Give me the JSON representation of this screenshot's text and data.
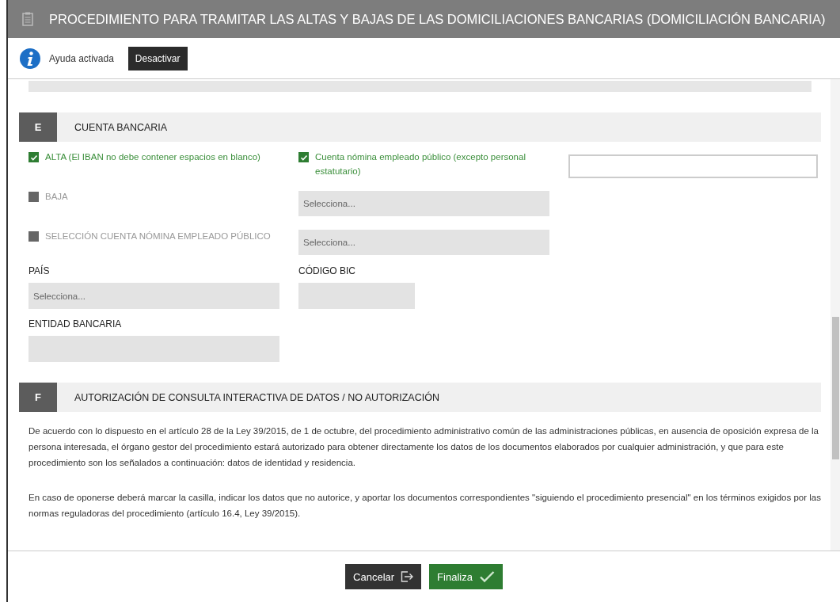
{
  "window": {
    "title": "PROCEDIMIENTO PARA TRAMITAR LAS ALTAS Y BAJAS DE LAS DOMICILIACIONES BANCARIAS (DOMICILIACIÓN BANCARIA)"
  },
  "help": {
    "label": "Ayuda activada",
    "button": "Desactivar"
  },
  "section_e": {
    "letter": "E",
    "title": "CUENTA BANCARIA",
    "options": [
      {
        "label": "ALTA (El IBAN no debe contener espacios en blanco)",
        "checked": true
      },
      {
        "label": "BAJA",
        "checked": false
      },
      {
        "label": "SELECCIÓN CUENTA NÓMINA EMPLEADO PÚBLICO",
        "checked": false
      }
    ],
    "payroll_option": {
      "label": "Cuenta nómina empleado público (excepto personal estatutario)",
      "checked": true
    },
    "payroll_selects": [
      {
        "placeholder": "Selecciona..."
      },
      {
        "placeholder": "Selecciona..."
      }
    ],
    "fields": [
      {
        "label": "PAÍS",
        "placeholder": "Selecciona...",
        "kind": "wide"
      },
      {
        "label": "CÓDIGO BIC",
        "kind": "short"
      },
      {
        "label": "ENTIDAD BANCARIA",
        "kind": "wide"
      }
    ]
  },
  "section_f": {
    "letter": "F",
    "title": "AUTORIZACIÓN DE CONSULTA INTERACTIVA DE DATOS / NO AUTORIZACIÓN",
    "paragraphs": [
      "De acuerdo con lo dispuesto en el artículo 28 de la Ley 39/2015, de 1 de octubre, del procedimiento administrativo común de las administraciones públicas, en ausencia de oposición expresa de la persona interesada, el órgano gestor del procedimiento estará autorizado para obtener directamente los datos de los documentos elaborados por cualquier administración, y que para este procedimiento son los señalados a continuación: datos de identidad y residencia.",
      "En caso de oponerse deberá marcar la casilla, indicar los datos que no autorice, y aportar los documentos correspondientes \"siguiendo el procedimiento presencial\" en los términos exigidos por las normas reguladoras del procedimiento (artículo 16.4, Ley 39/2015)."
    ]
  },
  "footer_buttons": [
    {
      "label": "Cancelar",
      "kind": "cancel"
    },
    {
      "label": "Finaliza",
      "kind": "finish"
    }
  ]
}
